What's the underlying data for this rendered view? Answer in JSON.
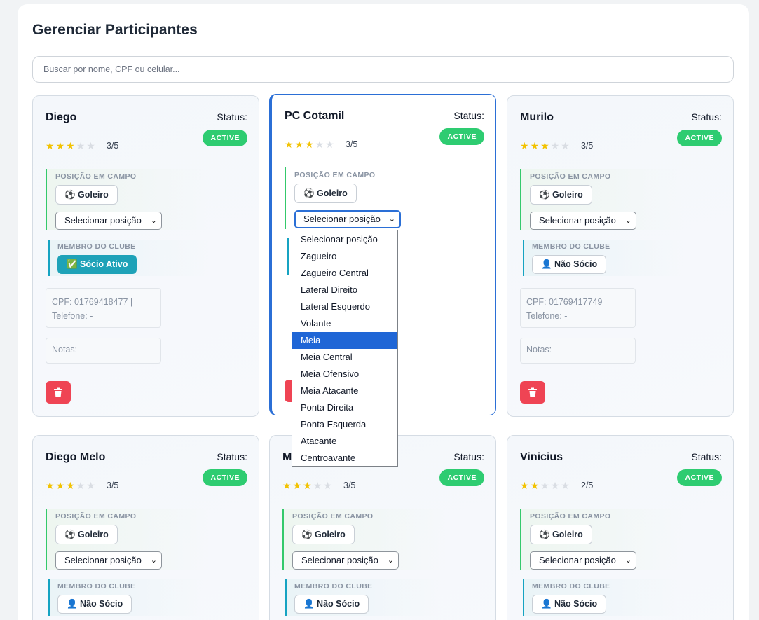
{
  "page": {
    "title": "Gerenciar Participantes",
    "search_placeholder": "Buscar por nome, CPF ou celular..."
  },
  "labels": {
    "status": "Status:",
    "position_section": "POSIÇÃO EM CAMPO",
    "club_section": "MEMBRO DO CLUBE",
    "select_position": "Selecionar posição"
  },
  "colors": {
    "active_badge": "#2ecc71",
    "star_on": "#f2c200",
    "socio_ativo": "#1ea2b8",
    "delete": "#ef4454",
    "selection": "#1f66d6"
  },
  "cards": [
    {
      "name": "Diego",
      "status": "ACTIVE",
      "rating": 3,
      "rating_text": "3/5",
      "position": "⚽ Goleiro",
      "club": "✅ Sócio Ativo",
      "cpf": "CPF: 01769418477 |",
      "phone": "Telefone: -",
      "notes": "Notas: -"
    },
    {
      "name": "PC Cotamil",
      "status": "ACTIVE",
      "rating": 3,
      "rating_text": "3/5",
      "position": "⚽ Goleiro",
      "club": "",
      "cpf": "",
      "phone": "",
      "notes": ""
    },
    {
      "name": "Murilo",
      "status": "ACTIVE",
      "rating": 3,
      "rating_text": "3/5",
      "position": "⚽ Goleiro",
      "club": "👤 Não Sócio",
      "cpf": "CPF: 01769417749 |",
      "phone": "Telefone: -",
      "notes": "Notas: -"
    },
    {
      "name": "Diego Melo",
      "status": "ACTIVE",
      "rating": 3,
      "rating_text": "3/5",
      "position": "⚽ Goleiro",
      "club": "👤 Não Sócio"
    },
    {
      "name": "M",
      "status": "ACTIVE",
      "rating": 3,
      "rating_text": "3/5",
      "position": "⚽ Goleiro",
      "club": "👤 Não Sócio"
    },
    {
      "name": "Vinicius",
      "status": "ACTIVE",
      "rating": 2,
      "rating_text": "2/5",
      "position": "⚽ Goleiro",
      "club": "👤 Não Sócio"
    }
  ],
  "dropdown": {
    "highlighted": "Meia",
    "options": [
      "Selecionar posição",
      "Zagueiro",
      "Zagueiro Central",
      "Lateral Direito",
      "Lateral Esquerdo",
      "Volante",
      "Meia",
      "Meia Central",
      "Meia Ofensivo",
      "Meia Atacante",
      "Ponta Direita",
      "Ponta Esquerda",
      "Atacante",
      "Centroavante"
    ]
  }
}
